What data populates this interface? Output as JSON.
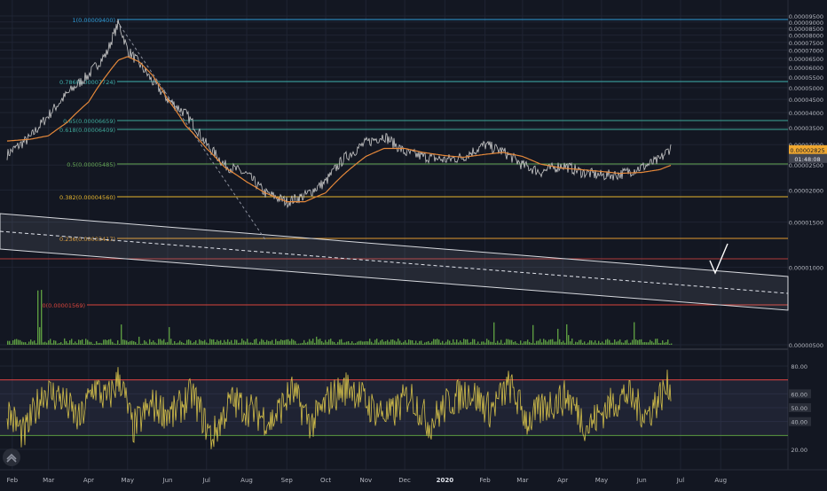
{
  "colors": {
    "background": "#131722",
    "grid": "#1f2433",
    "axis_text": "#b2b5be",
    "price": "#c9c9c9",
    "ma": "#e5883a",
    "volume": "#5b9a41",
    "rsi": "#d4c04a",
    "rsi_upper": "#e04545",
    "rsi_lower": "#5b9a41",
    "channel": "#d7d9de",
    "current_price_tag": "#f0a830",
    "timer_tag": "#434651"
  },
  "price_axis": {
    "labels": [
      "0.00009500",
      "0.00009000",
      "0.00008500",
      "0.00008000",
      "0.00007500",
      "0.00007000",
      "0.00006500",
      "0.00006000",
      "0.00005500",
      "0.00005000",
      "0.00004500",
      "0.00004000",
      "0.00003500",
      "0.00003000",
      "0.00002500",
      "0.00002000",
      "0.00001500",
      "0.00001000",
      "0.00000500"
    ],
    "current_price": "0.00002825",
    "countdown": "01:48:08"
  },
  "rsi_axis": {
    "labels": [
      "80.00",
      "60.00",
      "50.00",
      "40.00",
      "20.00"
    ]
  },
  "time_axis": {
    "labels": [
      "Feb",
      "Mar",
      "Apr",
      "May",
      "Jun",
      "Jul",
      "Aug",
      "Sep",
      "Oct",
      "Nov",
      "Dec",
      "2020",
      "Feb",
      "Mar",
      "Apr",
      "May",
      "Jun",
      "Jul",
      "Aug"
    ]
  },
  "fib_levels": [
    {
      "label": "1(0.00009400)",
      "color": "#2e9bd6"
    },
    {
      "label": "0.786(0.00007724)",
      "color": "#3fb3b0"
    },
    {
      "label": "0.65(0.00006659)",
      "color": "#3fa89a"
    },
    {
      "label": "0.618(0.00006409)",
      "color": "#3fa89a"
    },
    {
      "label": "0.5(0.00005485)",
      "color": "#66a855"
    },
    {
      "label": "0.382(0.00004560)",
      "color": "#e5b52e"
    },
    {
      "label": "0.236(0.00003417)",
      "color": "#e09a2e"
    },
    {
      "label": "0(0.00001569)",
      "color": "#d8453c"
    }
  ],
  "chart_data": [
    {
      "type": "line",
      "title": "",
      "xlabel": "",
      "ylabel": "",
      "ylim": [
        5e-06,
        9.5e-05
      ],
      "x": [
        "2019-01-28",
        "2019-02-15",
        "2019-03-01",
        "2019-03-15",
        "2019-04-01",
        "2019-04-15",
        "2019-04-24",
        "2019-05-01",
        "2019-05-10",
        "2019-05-20",
        "2019-06-01",
        "2019-06-15",
        "2019-07-01",
        "2019-07-15",
        "2019-08-01",
        "2019-08-15",
        "2019-09-01",
        "2019-09-15",
        "2019-10-01",
        "2019-10-15",
        "2019-11-01",
        "2019-11-15",
        "2019-12-01",
        "2019-12-15",
        "2020-01-01",
        "2020-01-15",
        "2020-02-01",
        "2020-02-15",
        "2020-03-01",
        "2020-03-15",
        "2020-04-01",
        "2020-04-15",
        "2020-05-01",
        "2020-05-15",
        "2020-06-01",
        "2020-06-15",
        "2020-06-24"
      ],
      "series": [
        {
          "values": [
            2.75e-05,
            3.2e-05,
            3.9e-05,
            4.7e-05,
            5.6e-05,
            6.8e-05,
            8.9e-05,
            7e-05,
            6.2e-05,
            5.3e-05,
            4.5e-05,
            3.95e-05,
            3e-05,
            2.5e-05,
            2.3e-05,
            1.95e-05,
            1.8e-05,
            1.9e-05,
            2.15e-05,
            2.65e-05,
            3.05e-05,
            3.25e-05,
            2.8e-05,
            2.7e-05,
            2.62e-05,
            2.68e-05,
            3e-05,
            2.82e-05,
            2.5e-05,
            2.35e-05,
            2.5e-05,
            2.35e-05,
            2.28e-05,
            2.3e-05,
            2.45e-05,
            2.62e-05,
            2.95e-05
          ]
        },
        {
          "values": [
            3.1e-05,
            3.15e-05,
            3.25e-05,
            3.65e-05,
            4.4e-05,
            5.6e-05,
            6.4e-05,
            6.6e-05,
            6.3e-05,
            5.6e-05,
            4.5e-05,
            3.55e-05,
            2.9e-05,
            2.45e-05,
            2.15e-05,
            1.95e-05,
            1.8e-05,
            1.8e-05,
            1.95e-05,
            2.3e-05,
            2.7e-05,
            2.9e-05,
            2.9e-05,
            2.8e-05,
            2.72e-05,
            2.68e-05,
            2.75e-05,
            2.8e-05,
            2.7e-05,
            2.52e-05,
            2.43e-05,
            2.4e-05,
            2.36e-05,
            2.32e-05,
            2.34e-05,
            2.4e-05,
            2.5e-05
          ]
        }
      ]
    },
    {
      "type": "line",
      "title": "",
      "xlabel": "",
      "ylabel": "",
      "ylim": [
        15,
        90
      ],
      "x": [
        "2019-01-28",
        "2019-02-10",
        "2019-02-25",
        "2019-03-10",
        "2019-03-25",
        "2019-04-05",
        "2019-04-15",
        "2019-04-25",
        "2019-05-05",
        "2019-05-20",
        "2019-06-05",
        "2019-06-20",
        "2019-07-05",
        "2019-07-20",
        "2019-08-05",
        "2019-08-20",
        "2019-09-05",
        "2019-09-20",
        "2019-10-05",
        "2019-10-20",
        "2019-11-05",
        "2019-11-20",
        "2019-12-05",
        "2019-12-20",
        "2020-01-05",
        "2020-01-20",
        "2020-02-05",
        "2020-02-20",
        "2020-03-05",
        "2020-03-20",
        "2020-04-05",
        "2020-04-20",
        "2020-05-05",
        "2020-05-20",
        "2020-06-05",
        "2020-06-15",
        "2020-06-24"
      ],
      "series": [
        {
          "values": [
            48,
            30,
            62,
            58,
            40,
            66,
            55,
            72,
            35,
            52,
            45,
            60,
            28,
            55,
            48,
            40,
            62,
            38,
            58,
            66,
            50,
            44,
            60,
            38,
            55,
            62,
            48,
            66,
            40,
            52,
            58,
            36,
            50,
            60,
            44,
            58,
            68
          ]
        }
      ],
      "reference_lines": [
        70,
        30
      ]
    }
  ]
}
